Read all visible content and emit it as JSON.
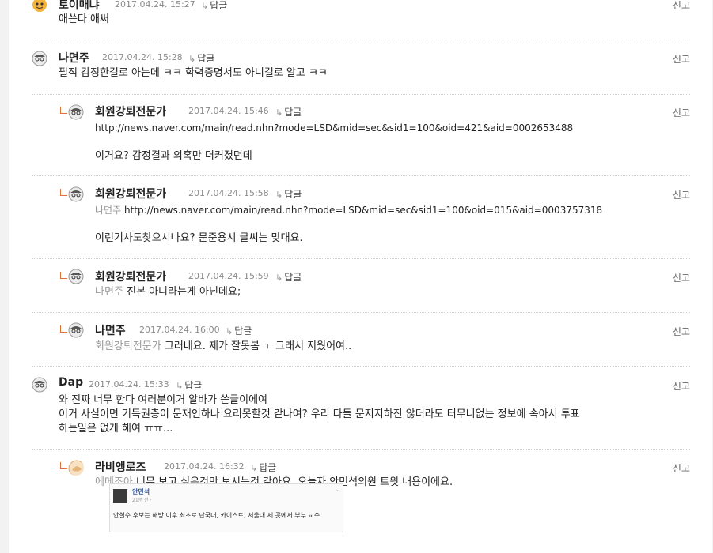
{
  "comments": [
    {
      "nick": "토이매냐",
      "date": "2017.04.24. 15:27",
      "reply": "답글",
      "report": "신고",
      "lines": [
        "애쓴다 애써"
      ],
      "mention": ""
    },
    {
      "nick": "나면주",
      "date": "2017.04.24. 15:28",
      "reply": "답글",
      "report": "신고",
      "lines": [
        "필적 감정한걸로 아는데 ㅋㅋ 학력증명서도 아니걸로 알고 ㅋㅋ"
      ],
      "mention": ""
    },
    {
      "nick": "회원강퇴전문가",
      "date": "2017.04.24. 15:46",
      "reply": "답글",
      "report": "신고",
      "lines": [
        "http://news.naver.com/main/read.nhn?mode=LSD&mid=sec&sid1=100&oid=421&aid=0002653488",
        "이거요? 감정결과 의혹만 더커졌던데"
      ],
      "mention": ""
    },
    {
      "nick": "회원강퇴전문가",
      "date": "2017.04.24. 15:58",
      "reply": "답글",
      "report": "신고",
      "lines": [
        "http://news.naver.com/main/read.nhn?mode=LSD&mid=sec&sid1=100&oid=015&aid=0003757318",
        "이런기사도찾으시나요? 문준용시 글씨는 맞대요."
      ],
      "mention": "나면주"
    },
    {
      "nick": "회원강퇴전문가",
      "date": "2017.04.24. 15:59",
      "reply": "답글",
      "report": "신고",
      "lines": [
        "진본 아니라는게 아닌데요;"
      ],
      "mention": "나면주"
    },
    {
      "nick": "나면주",
      "date": "2017.04.24. 16:00",
      "reply": "답글",
      "report": "신고",
      "lines": [
        "그러네요. 제가 잘못봄 ㅜ 그래서 지웠어여.."
      ],
      "mention": "회원강퇴전문가"
    },
    {
      "nick": "Dap",
      "date": "2017.04.24. 15:33",
      "reply": "답글",
      "report": "신고",
      "lines": [
        "와 진짜 너무 한다 여러분이거 알바가 쓴글이에여",
        "이거 사실이면 기득권층이 문재인하나 요리못할것 같나여? 우리 다들 문지지하진 않더라도 터무니없는 정보에 속아서 투표",
        "하는일은 없게 해여 ㅠㅠ..."
      ],
      "mention": ""
    },
    {
      "nick": "라비앵로즈",
      "date": "2017.04.24. 16:32",
      "reply": "답글",
      "report": "신고",
      "lines": [
        "너무 보고 싶은것만 보시는것 같아요. 오늘자 안민석의원 트윗 내용이에요."
      ],
      "mention": "에메조아"
    }
  ],
  "embed": {
    "name": "안민석",
    "sub": "21분 전 · ",
    "text": "안철수 후보는 해방 이후 최초로 단국대, 카이스트, 서울대 세 곳에서 부부 교수"
  },
  "colors": {
    "accent": "#e0703a",
    "date": "#8a8a8a",
    "mention": "#999999"
  }
}
